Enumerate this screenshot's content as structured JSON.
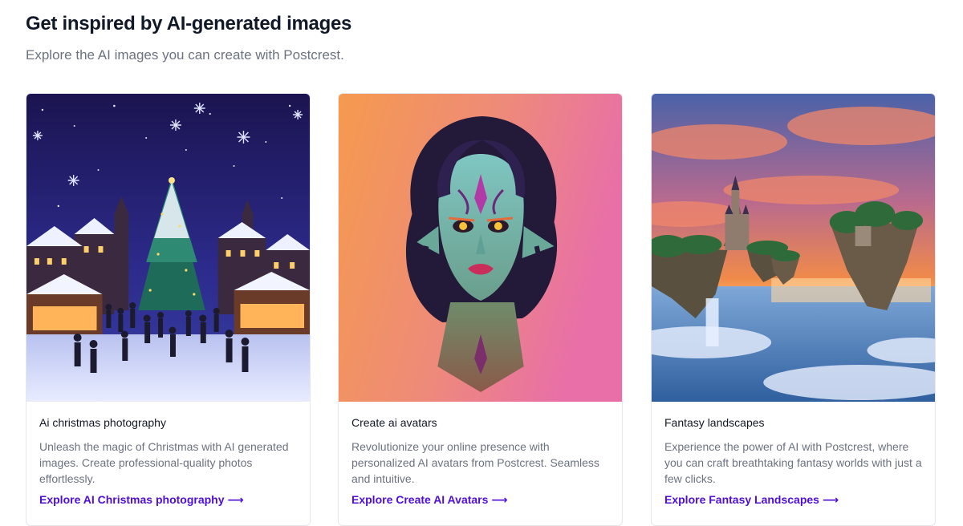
{
  "section": {
    "title": "Get inspired by AI-generated images",
    "subtitle": "Explore the AI images you can create with Postcrest."
  },
  "cards": [
    {
      "title": "Ai christmas photography",
      "description": "Unleash the magic of Christmas with AI generated images. Create professional-quality photos effortlessly.",
      "link_label": "Explore AI Christmas photography",
      "link_icon": "arrow-right-icon"
    },
    {
      "title": "Create ai avatars",
      "description": "Revolutionize your online presence with personalized AI avatars from Postcrest. Seamless and intuitive.",
      "link_label": "Explore Create AI Avatars",
      "link_icon": "arrow-right-icon"
    },
    {
      "title": "Fantasy landscapes",
      "description": "Experience the power of AI with Postcrest, where you can craft breathtaking fantasy worlds with just a few clicks.",
      "link_label": "Explore Fantasy Landscapes",
      "link_icon": "arrow-right-icon"
    }
  ],
  "colors": {
    "link": "#4f0dd8",
    "muted_text": "#6b7280",
    "heading_text": "#111827",
    "card_border": "#e5e7eb"
  }
}
